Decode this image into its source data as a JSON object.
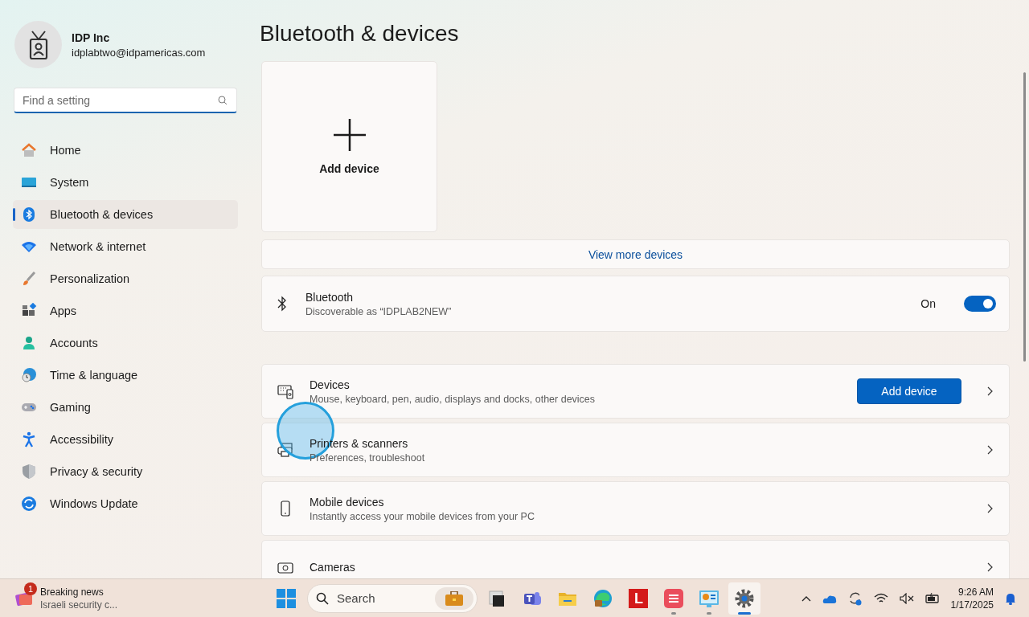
{
  "account": {
    "name": "IDP Inc",
    "email": "idplabtwo@idpamericas.com"
  },
  "search": {
    "placeholder": "Find a setting"
  },
  "nav": [
    {
      "label": "Home",
      "selected": false
    },
    {
      "label": "System",
      "selected": false
    },
    {
      "label": "Bluetooth & devices",
      "selected": true
    },
    {
      "label": "Network & internet",
      "selected": false
    },
    {
      "label": "Personalization",
      "selected": false
    },
    {
      "label": "Apps",
      "selected": false
    },
    {
      "label": "Accounts",
      "selected": false
    },
    {
      "label": "Time & language",
      "selected": false
    },
    {
      "label": "Gaming",
      "selected": false
    },
    {
      "label": "Accessibility",
      "selected": false
    },
    {
      "label": "Privacy & security",
      "selected": false
    },
    {
      "label": "Windows Update",
      "selected": false
    }
  ],
  "page_title": "Bluetooth & devices",
  "add_device_tile": {
    "label": "Add device"
  },
  "view_more": "View more devices",
  "bluetooth": {
    "title": "Bluetooth",
    "subtitle": "Discoverable as “IDPLAB2NEW”",
    "state_label": "On",
    "on": true
  },
  "rows": [
    {
      "title": "Devices",
      "subtitle": "Mouse, keyboard, pen, audio, displays and docks, other devices",
      "button": "Add device"
    },
    {
      "title": "Printers & scanners",
      "subtitle": "Preferences, troubleshoot"
    },
    {
      "title": "Mobile devices",
      "subtitle": "Instantly access your mobile devices from your PC"
    },
    {
      "title": "Cameras"
    }
  ],
  "taskbar": {
    "news": {
      "badge": "1",
      "title": "Breaking news",
      "subtitle": "Israeli security c..."
    },
    "search_placeholder": "Search",
    "apps": [
      {
        "running": false,
        "selected": false
      },
      {
        "running": false,
        "selected": false
      },
      {
        "running": false,
        "selected": false
      },
      {
        "running": false,
        "selected": false
      },
      {
        "running": false,
        "selected": false,
        "letter": "L"
      },
      {
        "running": true,
        "selected": false
      },
      {
        "running": true,
        "selected": false
      },
      {
        "running": true,
        "selected": true
      }
    ],
    "time": "9:26 AM",
    "date": "1/17/2025"
  }
}
